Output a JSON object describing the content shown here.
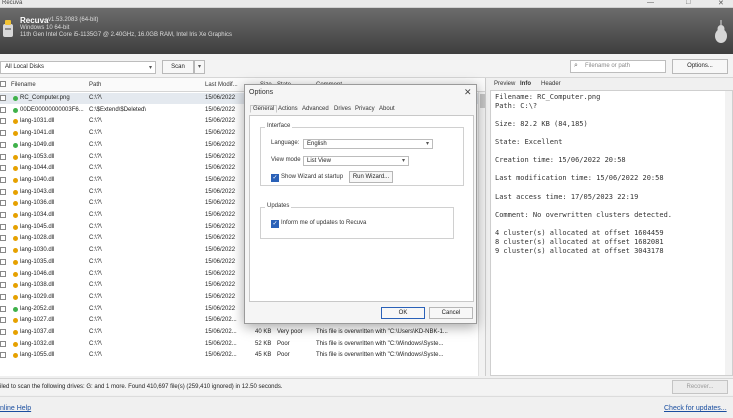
{
  "window": {
    "title": "Recuva"
  },
  "header": {
    "app_name": "Recuva",
    "version": "v1.53.2083 (64-bit)",
    "os": "Windows 10 64-bit",
    "hardware": "11th Gen Intel Core i5-1135G7 @ 2.40GHz, 16.0GB RAM, Intel Iris Xe Graphics"
  },
  "toolbar": {
    "drive": "All Local Disks",
    "scan_label": "Scan",
    "search_placeholder": "Filename or path",
    "options_label": "Options..."
  },
  "columns": [
    "Filename",
    "Path",
    "Last Modif...",
    "Size",
    "State",
    "Comment"
  ],
  "rows": [
    {
      "name": "RC_Computer.png",
      "path": "C:\\?\\",
      "date": "15/06/2022",
      "size": "",
      "state": "",
      "comment": "",
      "color": "#3fb14a"
    },
    {
      "name": "00DE00000000003F6...",
      "path": "C:\\$Extend\\$Deleted\\",
      "date": "15/06/2022",
      "size": "",
      "state": "",
      "comment": "",
      "color": "#3fb14a"
    },
    {
      "name": "lang-1031.dll",
      "path": "C:\\?\\",
      "date": "15/06/2022",
      "size": "",
      "state": "",
      "comment": "",
      "color": "#e6a100"
    },
    {
      "name": "lang-1041.dll",
      "path": "C:\\?\\",
      "date": "15/06/2022",
      "size": "",
      "state": "",
      "comment": "",
      "color": "#e6a100"
    },
    {
      "name": "lang-1049.dll",
      "path": "C:\\?\\",
      "date": "15/06/2022",
      "size": "",
      "state": "",
      "comment": "",
      "color": "#3fb14a"
    },
    {
      "name": "lang-1053.dll",
      "path": "C:\\?\\",
      "date": "15/06/2022",
      "size": "",
      "state": "",
      "comment": "",
      "color": "#e6a100"
    },
    {
      "name": "lang-1044.dll",
      "path": "C:\\?\\",
      "date": "15/06/2022",
      "size": "",
      "state": "",
      "comment": "",
      "color": "#e6a100"
    },
    {
      "name": "lang-1040.dll",
      "path": "C:\\?\\",
      "date": "15/06/2022",
      "size": "",
      "state": "",
      "comment": "",
      "color": "#e6a100"
    },
    {
      "name": "lang-1043.dll",
      "path": "C:\\?\\",
      "date": "15/06/2022",
      "size": "",
      "state": "",
      "comment": "",
      "color": "#e6a100"
    },
    {
      "name": "lang-1036.dll",
      "path": "C:\\?\\",
      "date": "15/06/2022",
      "size": "",
      "state": "",
      "comment": "",
      "color": "#e6a100"
    },
    {
      "name": "lang-1034.dll",
      "path": "C:\\?\\",
      "date": "15/06/2022",
      "size": "",
      "state": "",
      "comment": "",
      "color": "#e6a100"
    },
    {
      "name": "lang-1045.dll",
      "path": "C:\\?\\",
      "date": "15/06/2022",
      "size": "",
      "state": "",
      "comment": "",
      "color": "#e6a100"
    },
    {
      "name": "lang-1028.dll",
      "path": "C:\\?\\",
      "date": "15/06/2022",
      "size": "",
      "state": "",
      "comment": "",
      "color": "#e6a100"
    },
    {
      "name": "lang-1030.dll",
      "path": "C:\\?\\",
      "date": "15/06/2022",
      "size": "",
      "state": "",
      "comment": "",
      "color": "#e6a100"
    },
    {
      "name": "lang-1035.dll",
      "path": "C:\\?\\",
      "date": "15/06/2022",
      "size": "",
      "state": "",
      "comment": "",
      "color": "#e6a100"
    },
    {
      "name": "lang-1046.dll",
      "path": "C:\\?\\",
      "date": "15/06/2022",
      "size": "",
      "state": "",
      "comment": "",
      "color": "#e6a100"
    },
    {
      "name": "lang-1038.dll",
      "path": "C:\\?\\",
      "date": "15/06/2022",
      "size": "",
      "state": "",
      "comment": "",
      "color": "#e6a100"
    },
    {
      "name": "lang-1029.dll",
      "path": "C:\\?\\",
      "date": "15/06/2022",
      "size": "",
      "state": "",
      "comment": "",
      "color": "#e6a100"
    },
    {
      "name": "lang-2052.dll",
      "path": "C:\\?\\",
      "date": "15/06/2022",
      "size": "",
      "state": "",
      "comment": "",
      "color": "#3fb14a"
    },
    {
      "name": "lang-1027.dll",
      "path": "C:\\?\\",
      "date": "15/06/202...",
      "size": "50 KB",
      "state": "Very poor",
      "comment": "This file is overwritten with \"C:\\Users\\KD-NBK-1...",
      "color": "#e6a100"
    },
    {
      "name": "lang-1037.dll",
      "path": "C:\\?\\",
      "date": "15/06/202...",
      "size": "40 KB",
      "state": "Very poor",
      "comment": "This file is overwritten with \"C:\\Users\\KD-NBK-1...",
      "color": "#e6a100"
    },
    {
      "name": "lang-1032.dll",
      "path": "C:\\?\\",
      "date": "15/06/202...",
      "size": "52 KB",
      "state": "Poor",
      "comment": "This file is overwritten with \"C:\\Windows\\Syste...",
      "color": "#e6a100"
    },
    {
      "name": "lang-1055.dll",
      "path": "C:\\?\\",
      "date": "15/06/202...",
      "size": "45 KB",
      "state": "Poor",
      "comment": "This file is overwritten with \"C:\\Windows\\Syste...",
      "color": "#e6a100"
    }
  ],
  "panel": {
    "tabs": [
      "Preview",
      "Info",
      "Header"
    ],
    "lines": [
      "Filename: RC_Computer.png",
      "Path: C:\\?",
      "Size: 82.2 KB (84,185)",
      "State: Excellent",
      "Creation time: 15/06/2022 20:58",
      "Last modification time: 15/06/2022 20:58",
      "Last access time: 17/05/2023 22:19",
      "Comment: No overwritten clusters detected.",
      "4 cluster(s) allocated at offset 1604459",
      "8 cluster(s) allocated at offset 1682081",
      "9 cluster(s) allocated at offset 3043178"
    ]
  },
  "status": {
    "text": "iled to scan the following drives: G: and 1 more. Found 410,697 file(s) (259,410 ignored) in 12.50 seconds.",
    "recover_label": "Recover..."
  },
  "footer": {
    "help": "nline Help",
    "updates": "Check for updates..."
  },
  "dialog": {
    "title": "Options",
    "tabs": [
      "General",
      "Actions",
      "Advanced",
      "Drives",
      "Privacy",
      "About"
    ],
    "interface_label": "Interface",
    "language_label": "Language:",
    "language_value": "English",
    "viewmode_label": "View mode",
    "viewmode_value": "List View",
    "wizard_label": "Show Wizard at startup",
    "run_wizard_label": "Run Wizard...",
    "updates_label": "Updates",
    "inform_label": "Inform me of updates to Recuva",
    "ok_label": "OK",
    "cancel_label": "Cancel"
  }
}
